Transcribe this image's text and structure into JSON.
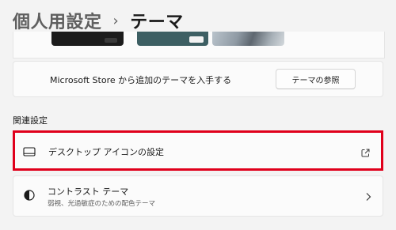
{
  "header": {
    "parent": "個人用設定",
    "separator": "›",
    "current": "テーマ"
  },
  "store_row": {
    "text": "Microsoft Store から追加のテーマを入手する",
    "button_label": "テーマの参照"
  },
  "related": {
    "title": "関連設定",
    "items": [
      {
        "label": "デスクトップ アイコンの設定",
        "icon": "desktop-monitor-icon",
        "trailing_icon": "open-external-icon",
        "highlighted": true
      },
      {
        "label": "コントラスト テーマ",
        "sub": "弱視、光過敏症のための配色テーマ",
        "icon": "contrast-icon",
        "trailing_icon": "chevron-right-icon"
      }
    ]
  },
  "colors": {
    "highlight_border": "#e0001b",
    "background": "#f3f3f3",
    "card": "#fbfbfb"
  }
}
